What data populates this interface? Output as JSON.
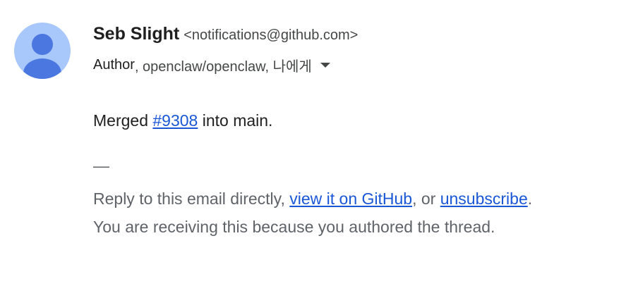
{
  "sender": {
    "name": "Seb Slight",
    "email": "<notifications@github.com>"
  },
  "recipients": {
    "role": "Author",
    "rest": ", openclaw/openclaw, 나에게"
  },
  "message": {
    "prefix": "Merged ",
    "pr_link": "#9308",
    "suffix": " into main."
  },
  "separator": "—",
  "footer": {
    "line1_prefix": "Reply to this email directly, ",
    "view_link": "view it on GitHub",
    "line1_middle": ", or ",
    "unsubscribe_link": "unsubscribe",
    "line1_suffix": ".",
    "line2": "You are receiving this because you authored the thread."
  },
  "colors": {
    "avatar_bg": "#a8c7fa",
    "avatar_fg": "#4a77e0",
    "link": "#1a57d6"
  },
  "icons": {
    "avatar": "person-icon",
    "details": "caret-down-icon"
  }
}
